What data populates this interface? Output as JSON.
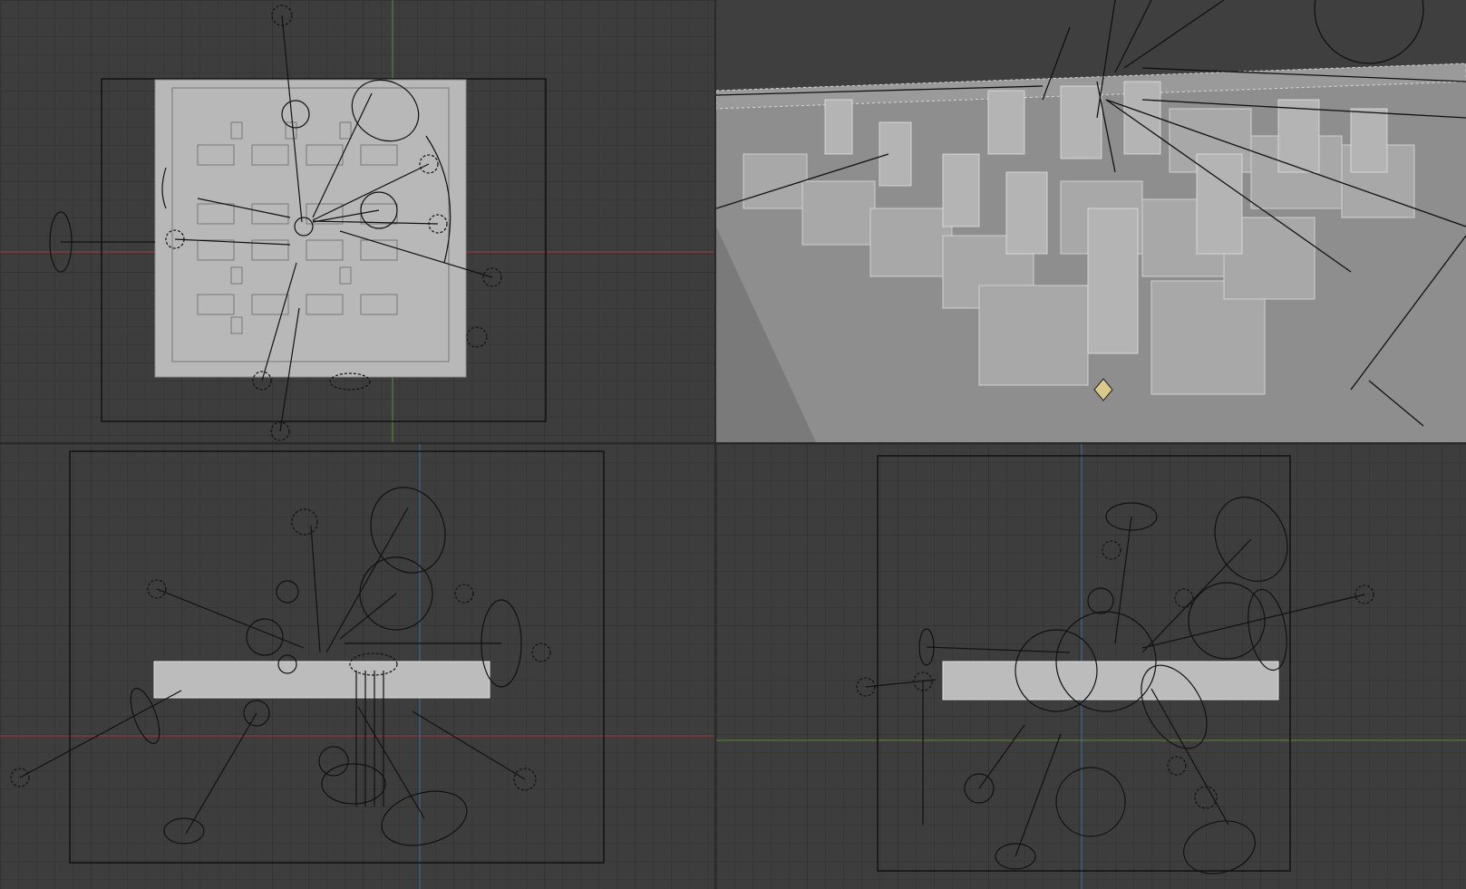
{
  "app": {
    "layout": "quad-view",
    "views": [
      "top",
      "perspective",
      "front",
      "side"
    ]
  },
  "colors": {
    "viewport_bg": "#3d3d3d",
    "grid_minor": "#373737",
    "grid_major": "#333333",
    "axis_x": "#a03a3a",
    "axis_y": "#5f8a3a",
    "axis_z": "#3a6aa0",
    "model": "#b5b5b5",
    "light_wire": "#111111"
  }
}
